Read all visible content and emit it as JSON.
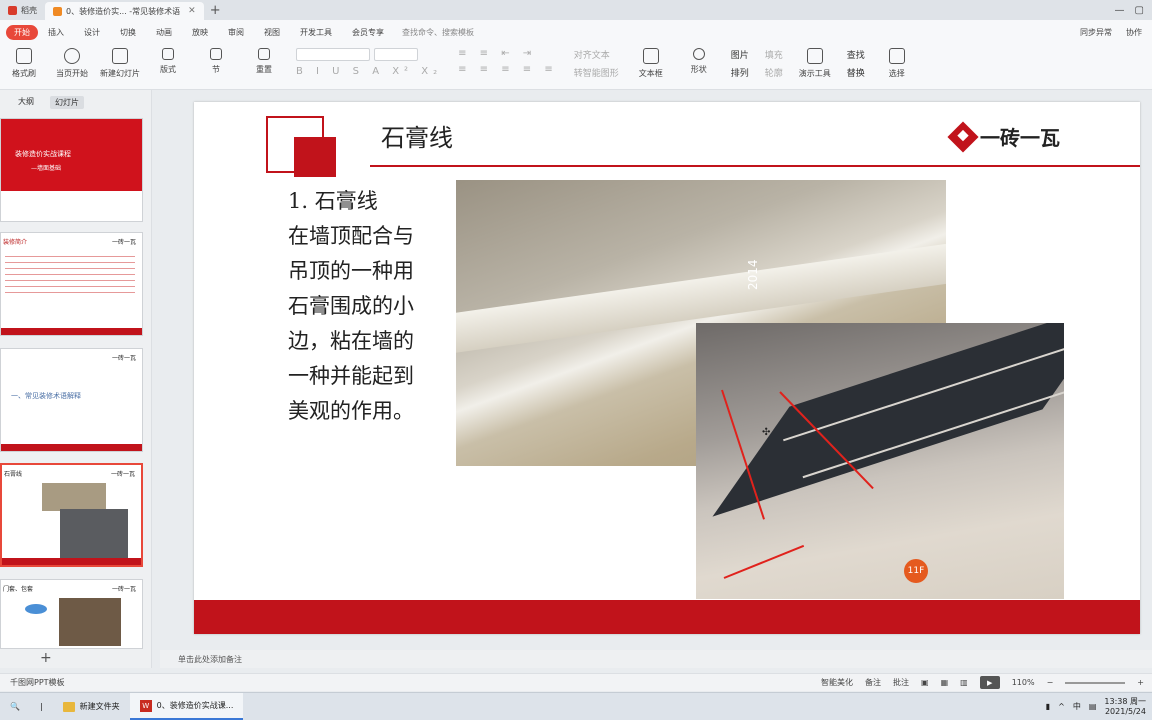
{
  "tabs": {
    "home": "稻壳",
    "doc": "0、装修造价实... -常见装修术语"
  },
  "menubar": {
    "start": "开始",
    "items": [
      "插入",
      "设计",
      "切换",
      "动画",
      "放映",
      "审阅",
      "视图",
      "开发工具",
      "会员专享"
    ],
    "search": "查找命令、搜索模板",
    "sync": "同步异常",
    "collab": "协作"
  },
  "ribbon": {
    "format_painter": "格式刷",
    "from_current": "当页开始",
    "new_slide": "新建幻灯片",
    "layout": "版式",
    "section": "节",
    "reset": "重置",
    "align_text": "对齐文本",
    "convert_smartart": "转智能图形",
    "textbox": "文本框",
    "shape": "形状",
    "arrange": "排列",
    "picture": "图片",
    "fill": "填充",
    "outline": "轮廓",
    "presenter_tools": "演示工具",
    "find": "查找",
    "replace": "替换",
    "select": "选择"
  },
  "sidebar": {
    "tab_outline": "大纲",
    "tab_slides": "幻灯片",
    "thumbs": [
      {
        "title": "装修造价实战课程",
        "subtitle": "—墙面基础"
      },
      {
        "title": "装修简介",
        "logo": "一砖一瓦"
      },
      {
        "title": "一、常见装修术语解释",
        "logo": "一砖一瓦"
      },
      {
        "title": "石膏线",
        "logo": "一砖一瓦"
      },
      {
        "title": "门套、包套",
        "logo": "一砖一瓦"
      }
    ]
  },
  "slide": {
    "title": "石膏线",
    "logo_text": "一砖一瓦",
    "body_lines": [
      "1.  石膏线",
      "在墙顶配合与",
      "吊顶的一种用",
      "石膏围成的小",
      "边，粘在墙的",
      "一种并能起到",
      "美观的作用。"
    ],
    "photo1_watermark": "2014",
    "photo2_sign": "11F"
  },
  "notes_placeholder": "单击此处添加备注",
  "status": {
    "template": "千图网PPT模板",
    "beautify": "智能美化",
    "notes": "备注",
    "comments": "批注",
    "zoom": "110%"
  },
  "taskbar": {
    "folder": "新建文件夹",
    "wps_doc": "0、装修造价实战课...",
    "time": "13:38 周一",
    "date": "2021/5/24",
    "input_method": "中"
  },
  "colors": {
    "accent": "#c1131b",
    "start_button": "#e8483a"
  }
}
